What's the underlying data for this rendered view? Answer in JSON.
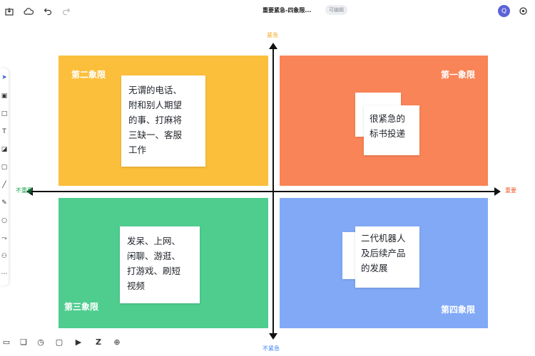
{
  "toolbar": {
    "doc_title": "重要紧急-四象限...",
    "badge": "可编辑",
    "avatar_initial": "Q"
  },
  "axes": {
    "top": "紧急",
    "bottom": "不紧急",
    "left": "不重要",
    "right": "重要",
    "colors": {
      "top": "#f5a623",
      "bottom": "#3b82f6",
      "left": "#16a34a",
      "right": "#ef5b2b"
    }
  },
  "quadrants": {
    "q1": {
      "label": "第一象限",
      "note": "很紧急的\n标书投递",
      "color": "#f98457"
    },
    "q2": {
      "label": "第二象限",
      "note": "无谓的电话、\n附和别人期望\n的事、打麻将\n三缺一、客服\n工作",
      "color": "#fbbf3b"
    },
    "q3": {
      "label": "第三象限",
      "note": "发呆、上网、\n闲聊、游逛、\n打游戏、刷短\n视频",
      "color": "#4ecd8f"
    },
    "q4": {
      "label": "第四象限",
      "note": "二代机器人\n及后续产品\n的发展",
      "color": "#81a9f6"
    }
  },
  "icons": {
    "top": [
      "save-icon",
      "cloud-icon",
      "undo-icon",
      "redo-icon"
    ],
    "left": [
      "cursor-icon",
      "frame-icon",
      "rectangle-icon",
      "text-icon",
      "sticky-note-icon",
      "shape-icon",
      "line-icon",
      "pen-icon",
      "eraser-icon",
      "connector-icon",
      "mindmap-icon",
      "more-icon"
    ],
    "bottom": [
      "minimap-icon",
      "layers-icon",
      "timer-icon",
      "comment-icon",
      "present-icon",
      "zoom-icon",
      "help-icon"
    ]
  }
}
